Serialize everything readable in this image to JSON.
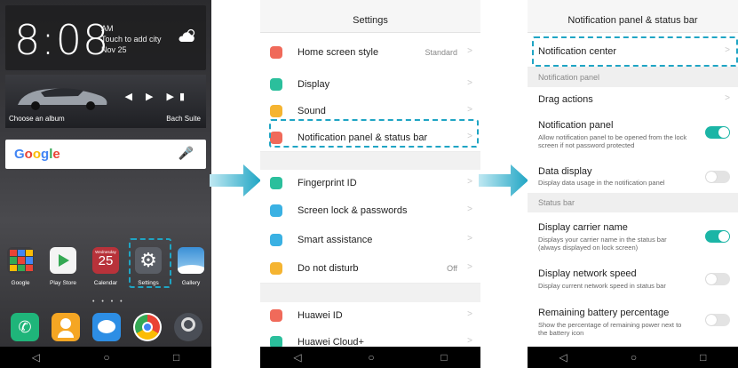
{
  "home": {
    "clock_time": "8:08",
    "am_pm": "AM",
    "weather_prompt": "Touch to add city",
    "date": "Nov 25",
    "music_album_label": "Choose an album",
    "music_track": "Bach Suite",
    "search_logo": "Google",
    "apps": [
      {
        "label": "Google"
      },
      {
        "label": "Play Store"
      },
      {
        "label": "Calendar",
        "weekday": "Wednesday",
        "day": "25"
      },
      {
        "label": "Settings"
      },
      {
        "label": "Gallery"
      }
    ]
  },
  "settings": {
    "title": "Settings",
    "items": [
      {
        "label": "Home screen style",
        "value": "Standard",
        "icon": "home-icon",
        "color": "#f06a5a"
      },
      {
        "label": "Display",
        "value": "",
        "icon": "display-icon",
        "color": "#2bbf9c"
      },
      {
        "label": "Sound",
        "value": "",
        "icon": "sound-icon",
        "color": "#f5b431"
      },
      {
        "label": "Notification panel & status bar",
        "value": "",
        "icon": "notification-icon",
        "color": "#f06a5a"
      },
      {
        "label": "Fingerprint ID",
        "value": "",
        "icon": "fingerprint-icon",
        "color": "#2bbf9c"
      },
      {
        "label": "Screen lock & passwords",
        "value": "",
        "icon": "lock-icon",
        "color": "#3ab1e3"
      },
      {
        "label": "Smart assistance",
        "value": "",
        "icon": "assistance-icon",
        "color": "#3ab1e3"
      },
      {
        "label": "Do not disturb",
        "value": "Off",
        "icon": "moon-icon",
        "color": "#f5b431"
      },
      {
        "label": "Huawei ID",
        "value": "",
        "icon": "huawei-id-icon",
        "color": "#f06a5a"
      },
      {
        "label": "Huawei Cloud+",
        "value": "",
        "icon": "cloud-icon",
        "color": "#2bbf9c"
      }
    ]
  },
  "notif": {
    "title": "Notification panel & status bar",
    "notification_center": "Notification center",
    "section_panel": "Notification panel",
    "drag_actions": "Drag actions",
    "notification_panel": {
      "label": "Notification panel",
      "desc": "Allow notification panel to be opened from the lock screen if not password protected",
      "on": true
    },
    "data_display": {
      "label": "Data display",
      "desc": "Display data usage in the notification panel",
      "on": false
    },
    "section_status": "Status bar",
    "carrier_name": {
      "label": "Display carrier name",
      "desc": "Displays your carrier name in the status bar (always displayed on lock screen)",
      "on": true
    },
    "network_speed": {
      "label": "Display network speed",
      "desc": "Display current network speed in status bar",
      "on": false
    },
    "battery_percentage": {
      "label": "Remaining battery percentage",
      "desc": "Show the percentage of remaining power next to the battery icon",
      "on": false
    }
  },
  "colors": {
    "highlight": "#1fa5c4",
    "toggle_on": "#1bb5a6"
  }
}
